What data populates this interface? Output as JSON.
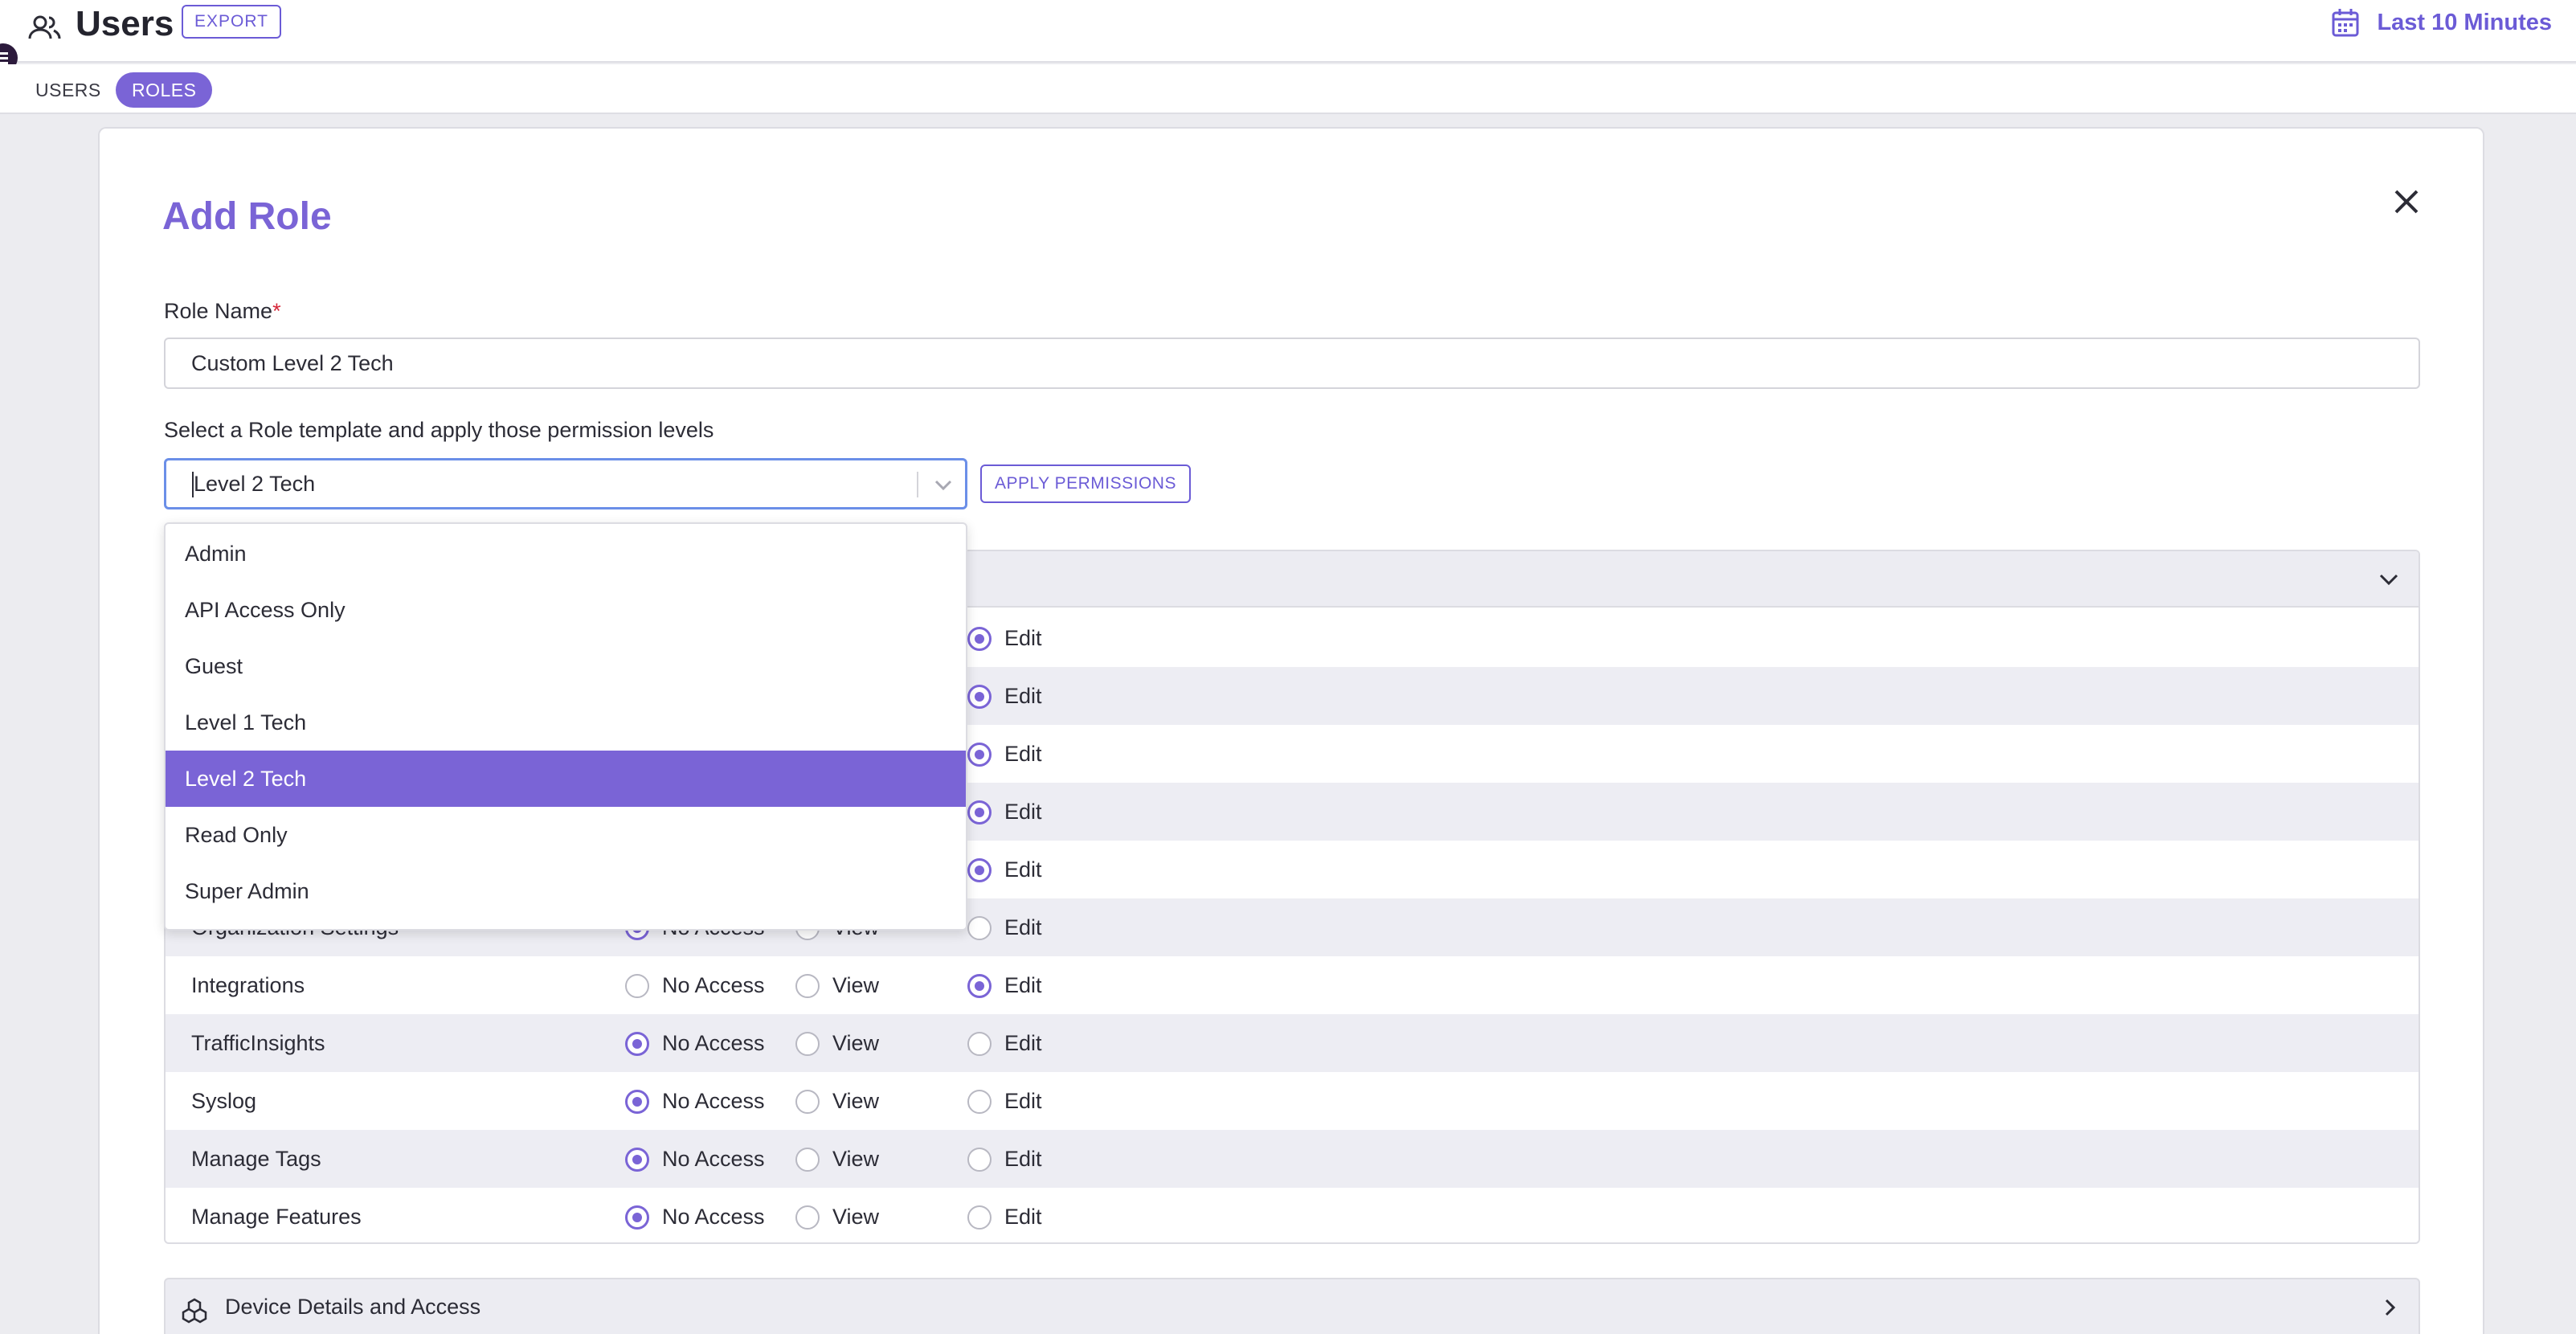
{
  "header": {
    "title": "Users",
    "export_label": "EXPORT",
    "time_range": "Last 10 Minutes"
  },
  "tabs": [
    {
      "label": "USERS",
      "active": false
    },
    {
      "label": "ROLES",
      "active": true
    }
  ],
  "modal": {
    "title": "Add Role",
    "role_name_label": "Role Name",
    "role_name_required": "*",
    "role_name_value": "Custom Level 2 Tech",
    "template_label": "Select a Role template and apply those permission levels",
    "template_value": "Level 2 Tech",
    "apply_label": "APPLY PERMISSIONS"
  },
  "dropdown": {
    "options": [
      "Admin",
      "API Access Only",
      "Guest",
      "Level 1 Tech",
      "Level 2 Tech",
      "Read Only",
      "Super Admin"
    ],
    "selected": "Level 2 Tech"
  },
  "permissions": {
    "option_labels": [
      "No Access",
      "View",
      "Edit"
    ],
    "rows": [
      {
        "name": "",
        "selected": "Edit"
      },
      {
        "name": "",
        "selected": "Edit"
      },
      {
        "name": "",
        "selected": "Edit"
      },
      {
        "name": "",
        "selected": "Edit"
      },
      {
        "name": "",
        "selected": "Edit"
      },
      {
        "name": "Organization Settings",
        "selected": "No Access"
      },
      {
        "name": "Integrations",
        "selected": "Edit"
      },
      {
        "name": "TrafficInsights",
        "selected": "No Access"
      },
      {
        "name": "Syslog",
        "selected": "No Access"
      },
      {
        "name": "Manage Tags",
        "selected": "No Access"
      },
      {
        "name": "Manage Features",
        "selected": "No Access"
      }
    ]
  },
  "device_section": {
    "title": "Device Details and Access"
  },
  "colors": {
    "accent": "#7a64d6",
    "required": "#d6283a"
  }
}
